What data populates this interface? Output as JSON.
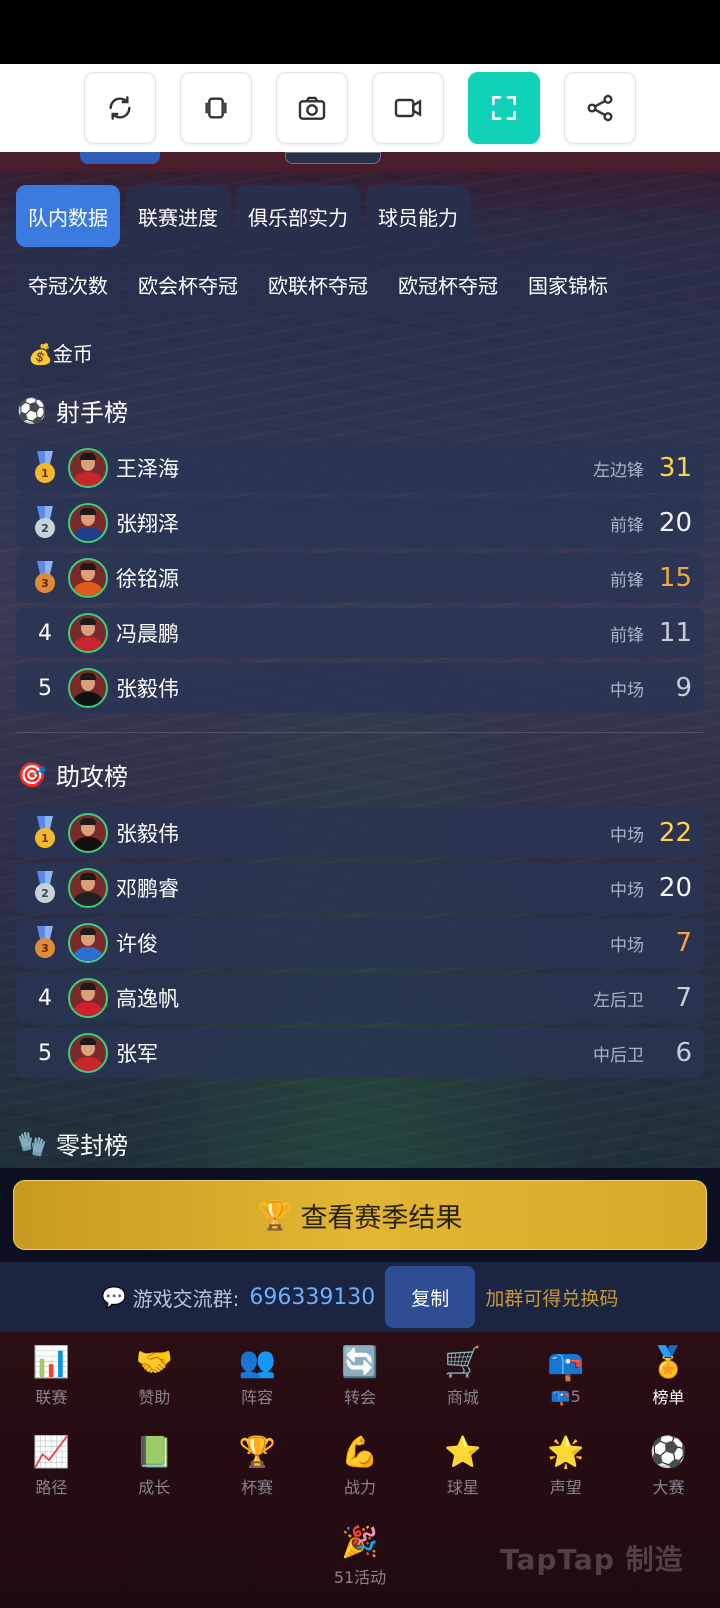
{
  "toolbar": {
    "icons": [
      "refresh-icon",
      "rotate-icon",
      "camera-icon",
      "video-icon",
      "fullscreen-icon",
      "share-icon"
    ],
    "active_index": 4,
    "accent": "#10d2b8"
  },
  "chips": {
    "row1": [
      "队内数据",
      "联赛进度",
      "俱乐部实力",
      "球员能力"
    ],
    "row2": [
      "夺冠次数",
      "欧会杯夺冠",
      "欧联杯夺冠",
      "欧冠杯夺冠",
      "国家锦标"
    ],
    "row3": [
      "💰金币"
    ],
    "active": "队内数据"
  },
  "scorers": {
    "title": "射手榜",
    "icon": "⚽",
    "rows": [
      {
        "rank": "1",
        "name": "王泽海",
        "pos": "左边锋",
        "value": "31"
      },
      {
        "rank": "2",
        "name": "张翔泽",
        "pos": "前锋",
        "value": "20"
      },
      {
        "rank": "3",
        "name": "徐铭源",
        "pos": "前锋",
        "value": "15"
      },
      {
        "rank": "4",
        "name": "冯晨鹏",
        "pos": "前锋",
        "value": "11"
      },
      {
        "rank": "5",
        "name": "张毅伟",
        "pos": "中场",
        "value": "9"
      }
    ]
  },
  "assists": {
    "title": "助攻榜",
    "icon": "🎯",
    "rows": [
      {
        "rank": "1",
        "name": "张毅伟",
        "pos": "中场",
        "value": "22"
      },
      {
        "rank": "2",
        "name": "邓鹏睿",
        "pos": "中场",
        "value": "20"
      },
      {
        "rank": "3",
        "name": "许俊",
        "pos": "中场",
        "value": "7"
      },
      {
        "rank": "4",
        "name": "高逸帆",
        "pos": "左后卫",
        "value": "7"
      },
      {
        "rank": "5",
        "name": "张军",
        "pos": "中后卫",
        "value": "6"
      }
    ]
  },
  "cleansheets": {
    "title": "零封榜",
    "icon": "🧤"
  },
  "result_button": {
    "icon": "🏆",
    "label": "查看赛季结果"
  },
  "group": {
    "icon": "💬",
    "label": "游戏交流群:",
    "number": "696339130",
    "copy": "复制",
    "hint": "加群可得兑换码"
  },
  "nav": [
    {
      "icon": "📊",
      "label": "联赛"
    },
    {
      "icon": "🤝",
      "label": "赞助"
    },
    {
      "icon": "👥",
      "label": "阵容"
    },
    {
      "icon": "🔄",
      "label": "转会"
    },
    {
      "icon": "🛒",
      "label": "商城"
    },
    {
      "icon": "📪",
      "label": "📪5"
    },
    {
      "icon": "🏅",
      "label": "榜单"
    },
    {
      "icon": "📈",
      "label": "路径"
    },
    {
      "icon": "📗",
      "label": "成长"
    },
    {
      "icon": "🏆",
      "label": "杯赛"
    },
    {
      "icon": "💪",
      "label": "战力"
    },
    {
      "icon": "⭐",
      "label": "球星"
    },
    {
      "icon": "🌟",
      "label": "声望"
    },
    {
      "icon": "⚽",
      "label": "大赛"
    }
  ],
  "nav_extra": {
    "icon": "🎉",
    "label": "51活动"
  },
  "watermark": "TapTap 制造"
}
